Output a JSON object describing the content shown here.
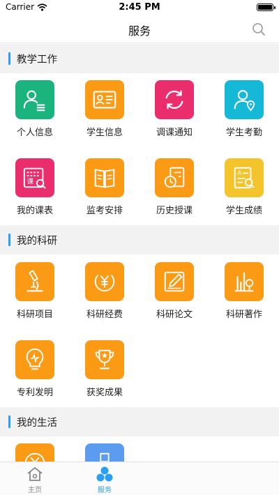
{
  "status_bar": {
    "carrier": "Carrier",
    "time": "2:45 PM"
  },
  "header": {
    "title": "服务"
  },
  "sections": {
    "teaching": {
      "title": "教学工作",
      "items": [
        {
          "label": "个人信息",
          "icon": "id-card-person-icon",
          "color": "#1bb37e"
        },
        {
          "label": "学生信息",
          "icon": "student-card-icon",
          "color": "#fb9a15"
        },
        {
          "label": "调课通知",
          "icon": "refresh-icon",
          "color": "#ea2d6c"
        },
        {
          "label": "学生考勤",
          "icon": "person-location-icon",
          "color": "#16b8d8"
        },
        {
          "label": "我的课表",
          "icon": "timetable-icon",
          "color": "#ea2d6c"
        },
        {
          "label": "监考安排",
          "icon": "open-book-icon",
          "color": "#fb9a15"
        },
        {
          "label": "历史授课",
          "icon": "history-icon",
          "color": "#fb9a15"
        },
        {
          "label": "学生成绩",
          "icon": "grade-report-icon",
          "color": "#f3c42c"
        }
      ]
    },
    "research": {
      "title": "我的科研",
      "items": [
        {
          "label": "科研项目",
          "icon": "microscope-icon",
          "color": "#fb9a15"
        },
        {
          "label": "科研经费",
          "icon": "yuan-coin-icon",
          "color": "#fb9a15"
        },
        {
          "label": "科研论文",
          "icon": "edit-document-icon",
          "color": "#fb9a15"
        },
        {
          "label": "科研著作",
          "icon": "bar-chart-icon",
          "color": "#fb9a15"
        },
        {
          "label": "专利发明",
          "icon": "lightbulb-icon",
          "color": "#fb9a15"
        },
        {
          "label": "获奖成果",
          "icon": "trophy-icon",
          "color": "#fb9a15"
        }
      ]
    },
    "life": {
      "title": "我的生活",
      "items": [
        {
          "label": "",
          "icon": "yuan-circle-icon",
          "color": "#fb9a15"
        },
        {
          "label": "",
          "icon": "plus-cross-icon",
          "color": "#5b9bf0"
        }
      ]
    }
  },
  "tabbar": {
    "home": {
      "label": "主页"
    },
    "services": {
      "label": "服务"
    }
  },
  "colors": {
    "accent": "#2b9ff2",
    "orange": "#fb9a15",
    "pink": "#ea2d6c",
    "green": "#1bb37e",
    "cyan": "#16b8d8",
    "yellow": "#f3c42c"
  }
}
